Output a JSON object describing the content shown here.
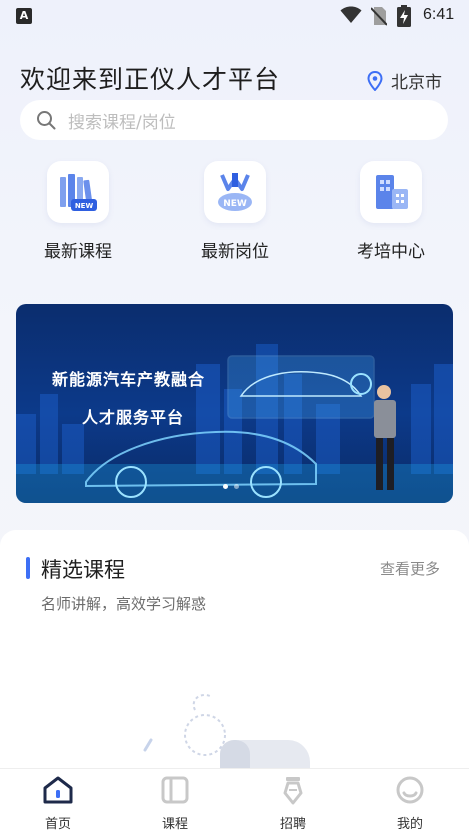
{
  "status_bar": {
    "time": "6:41",
    "app_indicator": "A"
  },
  "header": {
    "title": "欢迎来到正仪人才平台",
    "location": "北京市"
  },
  "search": {
    "placeholder": "搜索课程/岗位"
  },
  "quick_entries": [
    {
      "label": "最新课程",
      "icon": "new-courses-icon"
    },
    {
      "label": "最新岗位",
      "icon": "new-jobs-icon"
    },
    {
      "label": "考培中心",
      "icon": "exam-training-center-icon"
    }
  ],
  "banner": {
    "line1": "新能源汽车产教融合",
    "line2": "人才服务平台",
    "slide_count": 2,
    "active_slide": 1
  },
  "featured": {
    "title": "精选课程",
    "more": "查看更多",
    "subtitle": "名师讲解，高效学习解惑"
  },
  "tabs": [
    {
      "label": "首页",
      "icon": "home-icon",
      "active": true
    },
    {
      "label": "课程",
      "icon": "course-icon",
      "active": false
    },
    {
      "label": "招聘",
      "icon": "recruit-icon",
      "active": false
    },
    {
      "label": "我的",
      "icon": "profile-icon",
      "active": false
    }
  ],
  "colors": {
    "accent": "#3d6ff5",
    "tab_active": "#1e2a4a",
    "tab_inactive": "#c8c8c8"
  }
}
